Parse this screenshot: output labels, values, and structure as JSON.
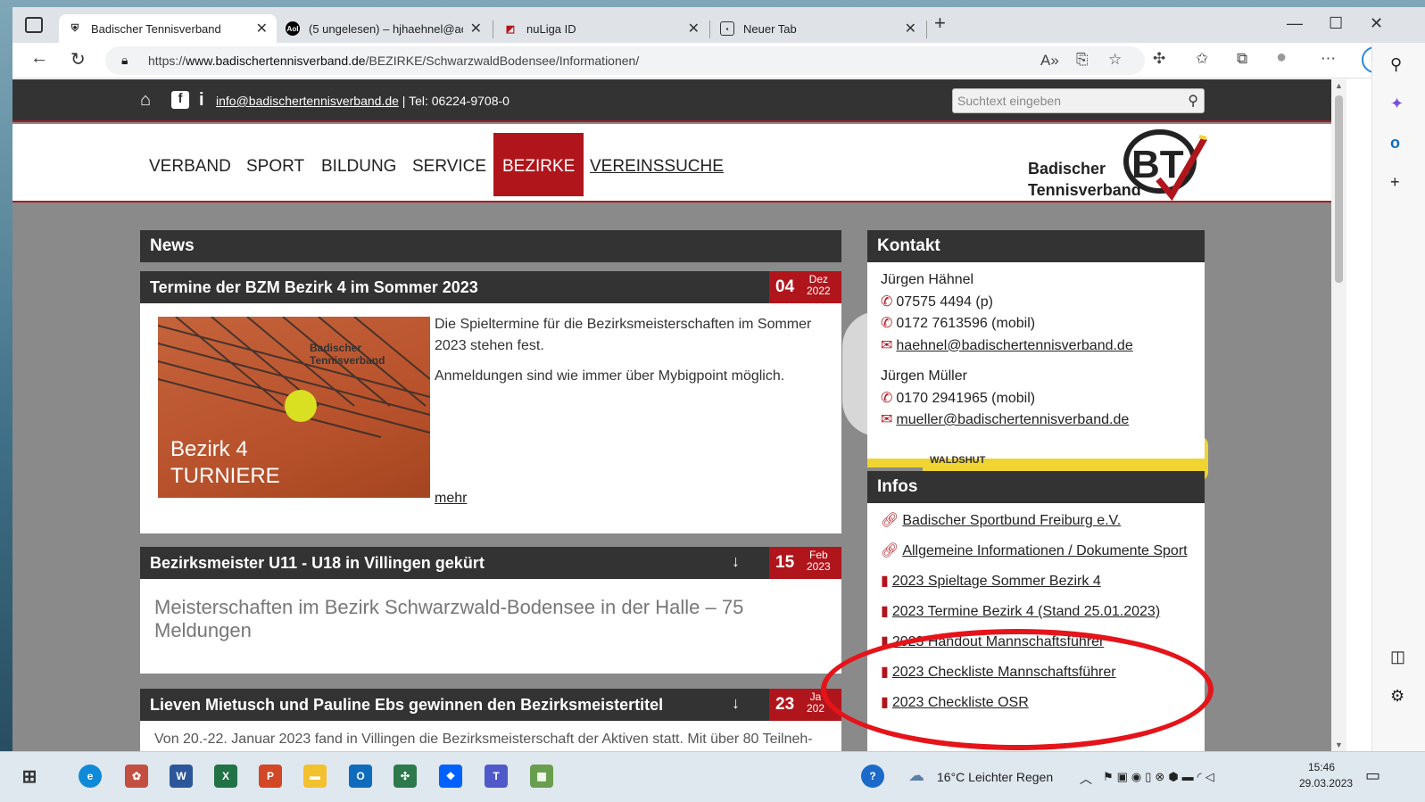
{
  "browser": {
    "tabs": [
      {
        "title": "Badischer Tennisverband",
        "active": true,
        "favicon": "btv-logo"
      },
      {
        "title": "(5 ungelesen) – hjhaehnel@aol.c",
        "active": false,
        "favicon": "aol-logo"
      },
      {
        "title": "nuLiga ID",
        "active": false,
        "favicon": "nuliga-logo"
      },
      {
        "title": "Neuer Tab",
        "active": false,
        "favicon": "newtab-icon"
      }
    ],
    "url_prefix": "https://",
    "url_domain": "www.badischertennisverband.de",
    "url_path": "/BEZIRKE/SchwarzwaldBodensee/Informationen/"
  },
  "site": {
    "topbar": {
      "email": "info@badischertennisverband.de",
      "phone_text": "| Tel: 06224-9708-0",
      "search_placeholder": "Suchtext eingeben"
    },
    "nav": [
      "VERBAND",
      "SPORT",
      "BILDUNG",
      "SERVICE",
      "BEZIRKE",
      "VEREINSSUCHE"
    ],
    "logo_line1": "Badischer",
    "logo_line2": "Tennisverband"
  },
  "news": {
    "heading": "News",
    "articles": [
      {
        "title": "Termine der BZM Bezirk 4 im Sommer 2023",
        "day": "04",
        "month": "Dez",
        "year": "2022",
        "image_caption_1": "Bezirk 4",
        "image_caption_2": "TURNIERE",
        "image_logo_1": "Badischer",
        "image_logo_2": "Tennisverband",
        "text1": "Die Spieltermine für die Bezirksmeisterschaften im Sommer 2023 stehen fest.",
        "text2": "Anmeldungen sind wie immer über Mybigpoint möglich.",
        "more": "mehr"
      },
      {
        "title": "Bezirksmeister U11 - U18 in Villingen gekürt",
        "day": "15",
        "month": "Feb",
        "year": "2023",
        "subtitle": "Meisterschaften im Bezirk Schwarzwald-Bodensee in der Halle – 75 Meldungen"
      },
      {
        "title": "Lieven Mietusch und Pauline Ebs gewinnen den Bezirksmeistertitel",
        "day": "23",
        "month": "Ja",
        "year": "202",
        "text": "Von 20.-22. Januar 2023 fand in Villingen die Bezirksmeisterschaft der Aktiven statt. Mit über 80 Teilneh-"
      }
    ]
  },
  "kontakt": {
    "heading": "Kontakt",
    "persons": [
      {
        "name": "Jürgen Hähnel",
        "phone1": "07575 4494 (p)",
        "phone2": "0172 7613596 (mobil)",
        "email": "haehnel@badischertennisverband.de"
      },
      {
        "name": "Jürgen Müller",
        "phone1": "0170 2941965 (mobil)",
        "email": "mueller@badischertennisverband.de"
      }
    ],
    "map_label": "WALDSHUT"
  },
  "infos": {
    "heading": "Infos",
    "items": [
      {
        "label": "Badischer Sportbund Freiburg e.V.",
        "icon": "link-icon"
      },
      {
        "label": "Allgemeine Informationen / Dokumente Sport",
        "icon": "link-icon"
      },
      {
        "label": "2023 Spieltage Sommer Bezirk 4",
        "icon": "document-icon"
      },
      {
        "label": "2023 Termine Bezirk 4 (Stand 25.01.2023)",
        "icon": "document-icon"
      },
      {
        "label": "2023 Handout Mannschaftsführer",
        "icon": "document-icon"
      },
      {
        "label": "2023 Checkliste Mannschaftsführer",
        "icon": "document-icon"
      },
      {
        "label": "2023 Checkliste OSR",
        "icon": "document-icon"
      }
    ]
  },
  "taskbar": {
    "weather": "16°C  Leichter Regen",
    "time": "15:46",
    "date": "29.03.2023"
  },
  "colors": {
    "accent": "#b1151c",
    "dark": "#333333",
    "annotation": "#e5141a"
  }
}
